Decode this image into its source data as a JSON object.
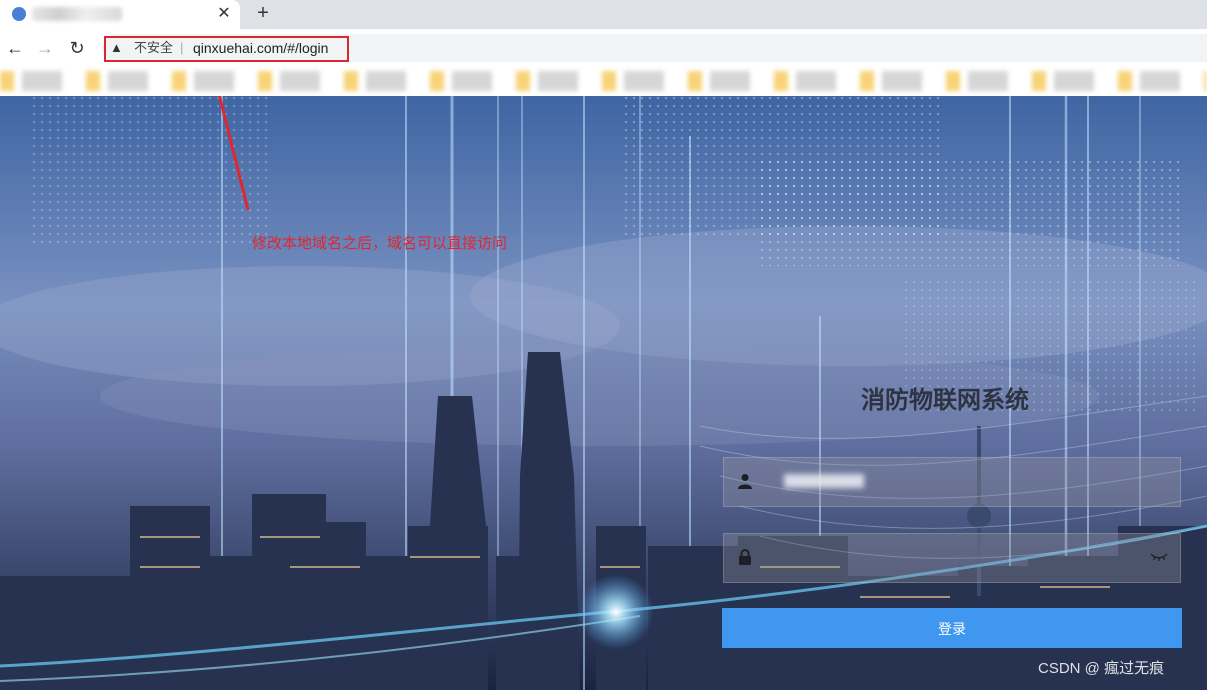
{
  "browser": {
    "tab": {
      "close_icon": "close-icon",
      "new_tab_icon": "plus-icon"
    },
    "toolbar": {
      "back_icon": "arrow-left-icon",
      "forward_icon": "arrow-right-icon",
      "reload_icon": "reload-icon",
      "security_icon": "warning-triangle-icon",
      "security_label": "不安全",
      "url": "qinxuehai.com/#/login"
    }
  },
  "annotation": {
    "text": "修改本地域名之后，域名可以直接访问",
    "color": "#e0272f"
  },
  "login": {
    "title": "消防物联网系统",
    "username_icon": "user-icon",
    "password_icon": "lock-icon",
    "eye_icon": "eye-closed-icon",
    "button_label": "登录",
    "button_color": "#3f97f0"
  },
  "watermark": "CSDN @ 瘋过无痕"
}
